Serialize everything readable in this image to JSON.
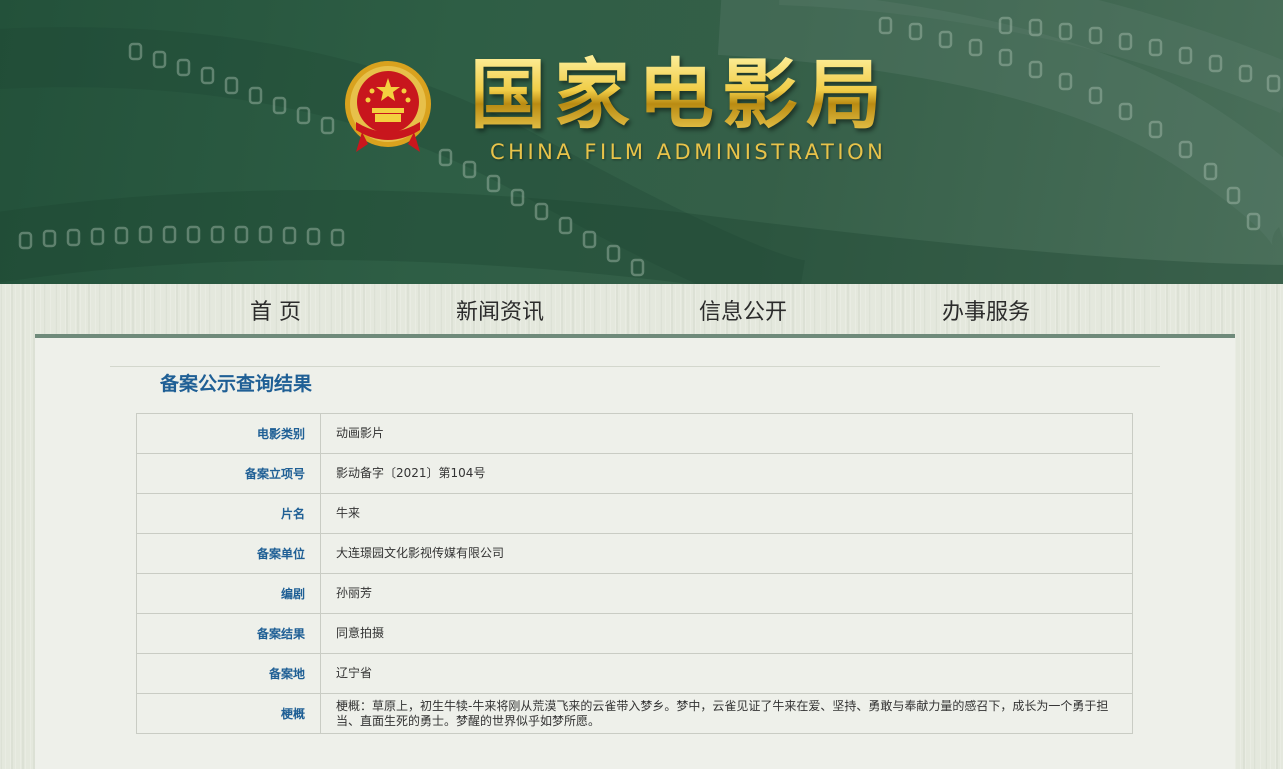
{
  "header": {
    "title_cn": "国家电影局",
    "title_en": "CHINA FILM ADMINISTRATION"
  },
  "nav": {
    "items": [
      {
        "label": "首 页"
      },
      {
        "label": "新闻资讯"
      },
      {
        "label": "信息公开"
      },
      {
        "label": "办事服务"
      }
    ]
  },
  "main": {
    "title": "备案公示查询结果",
    "rows": [
      {
        "label": "电影类别",
        "value": "动画影片"
      },
      {
        "label": "备案立项号",
        "value": "影动备字〔2021〕第104号"
      },
      {
        "label": "片名",
        "value": "牛来"
      },
      {
        "label": "备案单位",
        "value": "大连璟园文化影视传媒有限公司"
      },
      {
        "label": "编剧",
        "value": "孙丽芳"
      },
      {
        "label": "备案结果",
        "value": "同意拍摄"
      },
      {
        "label": "备案地",
        "value": "辽宁省"
      },
      {
        "label": "梗概",
        "value": "梗概：草原上，初生牛犊-牛来将刚从荒漠飞来的云雀带入梦乡。梦中，云雀见证了牛来在爱、坚持、勇敢与奉献力量的感召下，成长为一个勇于担当、直面生死的勇士。梦醒的世界似乎如梦所愿。"
      }
    ]
  },
  "colors": {
    "banner_green": "#2e5e45",
    "gold": "#e6c23c",
    "title_blue": "#1f5f95",
    "emblem_red": "#c8161d"
  },
  "icons": {
    "emblem": "national-emblem-icon"
  }
}
